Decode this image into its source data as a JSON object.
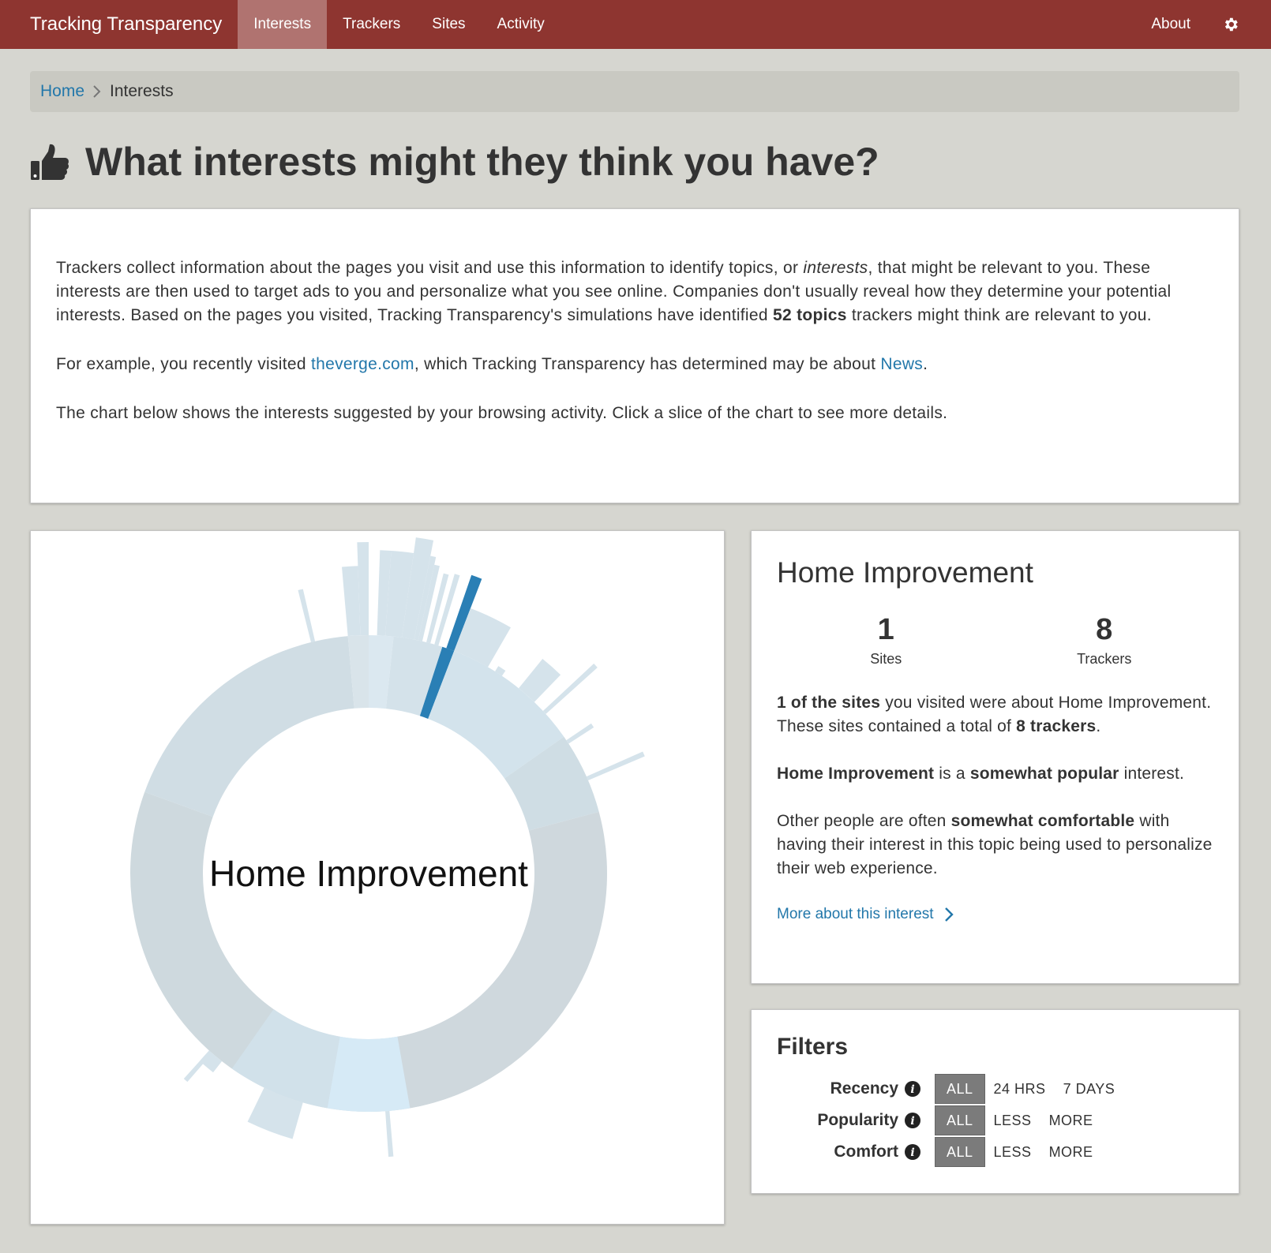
{
  "nav": {
    "brand": "Tracking Transparency",
    "items": [
      {
        "label": "Interests",
        "active": true
      },
      {
        "label": "Trackers"
      },
      {
        "label": "Sites"
      },
      {
        "label": "Activity"
      }
    ],
    "about": "About",
    "settings_icon": "gear-icon"
  },
  "breadcrumb": {
    "home": "Home",
    "current": "Interests"
  },
  "page": {
    "title": "What interests might they think you have?",
    "title_icon": "thumbs-up-icon"
  },
  "intro": {
    "p1_a": "Trackers collect information about the pages you visit and use this information to identify topics, or ",
    "p1_em": "interests",
    "p1_b": ", that might be relevant to you. These interests are then used to target ads to you and personalize what you see online. Companies don't usually reveal how they determine your potential interests. Based on the pages you visited, Tracking Transparency's simulations have identified ",
    "p1_strong": "52 topics",
    "p1_c": " trackers might think are relevant to you.",
    "p2_a": "For example, you recently visited ",
    "p2_site": "theverge.com",
    "p2_b": ", which Tracking Transparency has determined may be about ",
    "p2_topic": "News",
    "p2_c": ".",
    "p3": "The chart below shows the interests suggested by your browsing activity. Click a slice of the chart to see more details."
  },
  "chart": {
    "center_label": "Home Improvement",
    "highlight_color": "#2a7fb5"
  },
  "detail": {
    "title": "Home Improvement",
    "sites_value": "1",
    "sites_label": "Sites",
    "trackers_value": "8",
    "trackers_label": "Trackers",
    "t1_strong": "1 of the sites",
    "t1_a": " you visited were about Home Improvement. These sites contained a total of ",
    "t1_strong2": "8 trackers",
    "t1_b": ".",
    "t2_strong": "Home Improvement",
    "t2_a": " is a ",
    "t2_strong2": "somewhat popular",
    "t2_b": " interest.",
    "t3_a": "Other people are often ",
    "t3_strong": "somewhat comfortable",
    "t3_b": " with having their interest in this topic being used to personalize their web experience.",
    "more_link": "More about this interest"
  },
  "filters": {
    "title": "Filters",
    "rows": [
      {
        "label": "Recency",
        "options": [
          "ALL",
          "24 HRS",
          "7 DAYS"
        ],
        "selected": "ALL"
      },
      {
        "label": "Popularity",
        "options": [
          "ALL",
          "LESS",
          "MORE"
        ],
        "selected": "ALL"
      },
      {
        "label": "Comfort",
        "options": [
          "ALL",
          "LESS",
          "MORE"
        ],
        "selected": "ALL"
      }
    ]
  }
}
